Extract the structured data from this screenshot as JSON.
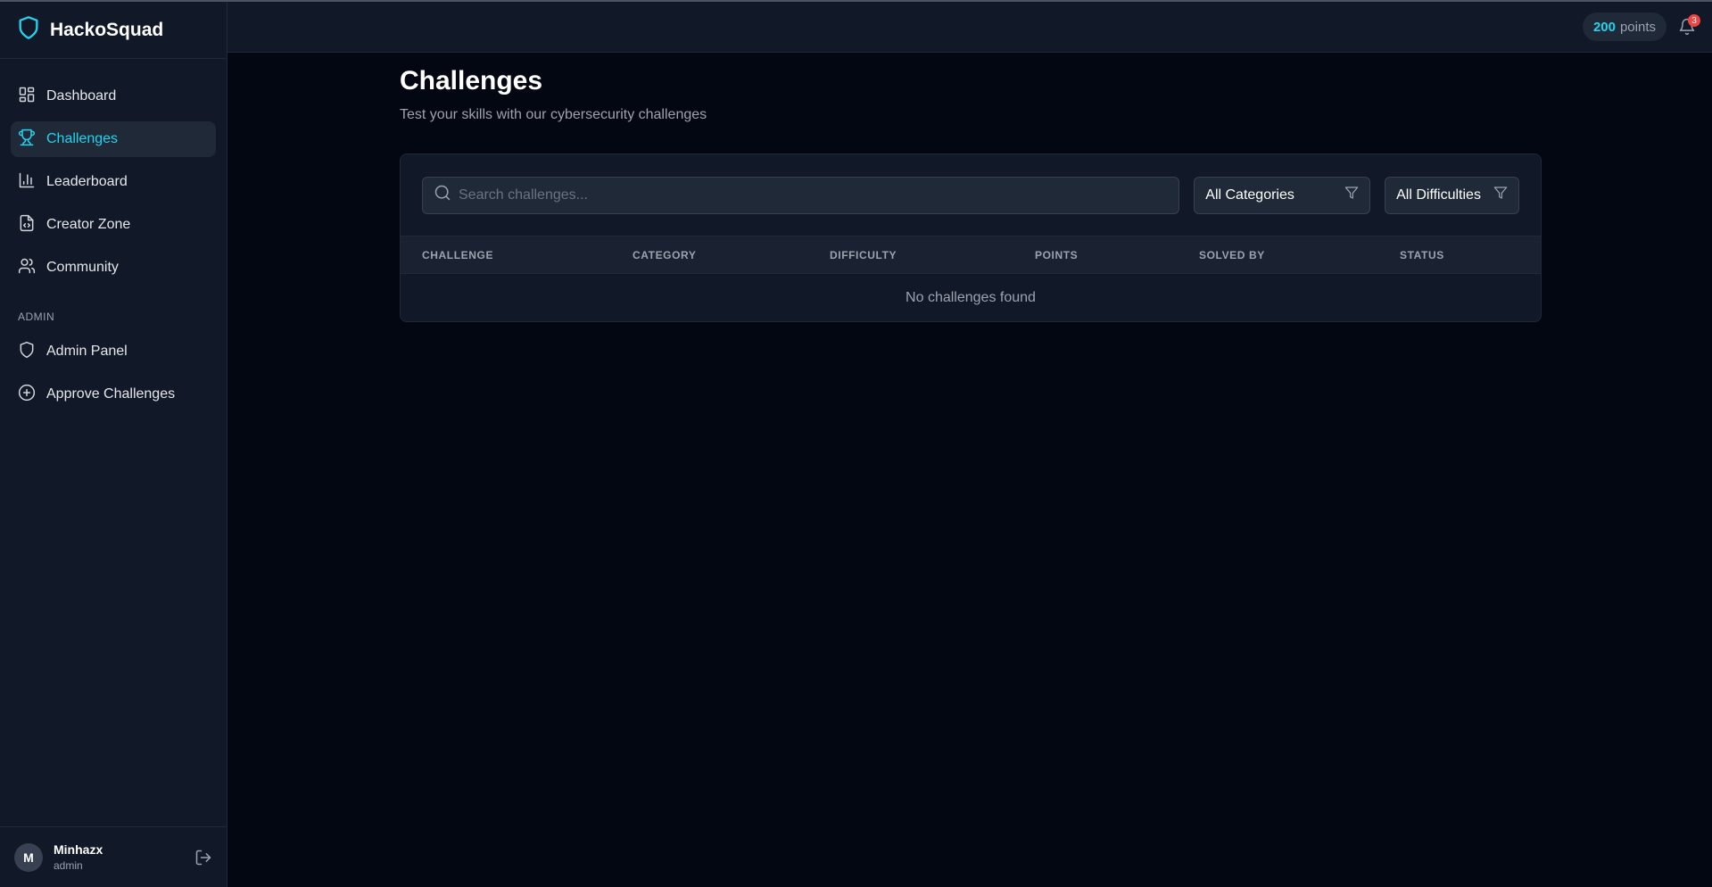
{
  "app": {
    "name": "HackoSquad",
    "accent": "#22d3ee"
  },
  "sidebar": {
    "items": [
      {
        "label": "Dashboard",
        "icon": "dashboard-icon"
      },
      {
        "label": "Challenges",
        "icon": "trophy-icon",
        "active": true
      },
      {
        "label": "Leaderboard",
        "icon": "bar-chart-icon"
      },
      {
        "label": "Creator Zone",
        "icon": "file-code-icon"
      },
      {
        "label": "Community",
        "icon": "users-icon"
      }
    ],
    "admin_section": "ADMIN",
    "admin_items": [
      {
        "label": "Admin Panel",
        "icon": "shield-icon"
      },
      {
        "label": "Approve Challenges",
        "icon": "plus-circle-icon"
      }
    ],
    "user": {
      "initial": "M",
      "name": "Minhazx",
      "role": "admin"
    }
  },
  "header": {
    "points_value": "200",
    "points_label": "points",
    "notification_count": "3"
  },
  "main": {
    "title": "Challenges",
    "subtitle": "Test your skills with our cybersecurity challenges",
    "search_placeholder": "Search challenges...",
    "category_filter": "All Categories",
    "difficulty_filter": "All Difficulties",
    "columns": [
      "CHALLENGE",
      "CATEGORY",
      "DIFFICULTY",
      "POINTS",
      "SOLVED BY",
      "STATUS"
    ],
    "empty_message": "No challenges found"
  }
}
